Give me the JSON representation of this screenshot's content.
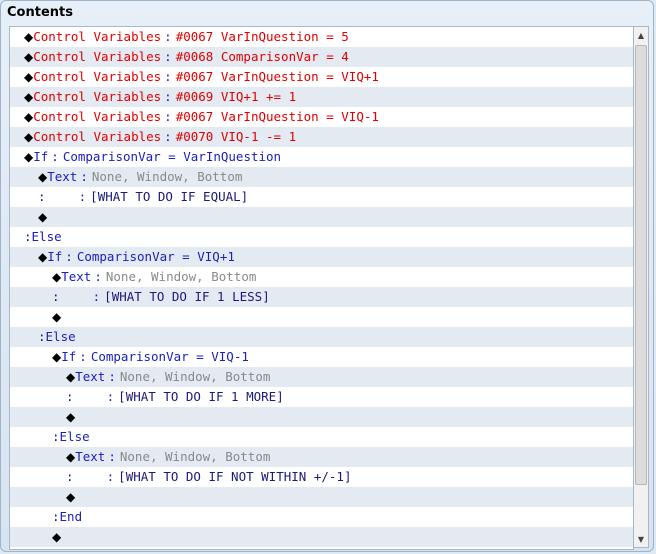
{
  "panel": {
    "title": "Contents"
  },
  "lines": [
    {
      "indent": 0,
      "prefix": "◆",
      "cmd": "Control Variables",
      "cmd_class": "red",
      "sep": ":",
      "args": "#0067 VarInQuestion = 5",
      "args_class": "red"
    },
    {
      "indent": 0,
      "prefix": "◆",
      "cmd": "Control Variables",
      "cmd_class": "red",
      "sep": ":",
      "args": "#0068 ComparisonVar = 4",
      "args_class": "red"
    },
    {
      "indent": 0,
      "prefix": "◆",
      "cmd": "Control Variables",
      "cmd_class": "red",
      "sep": ":",
      "args": "#0067 VarInQuestion = VIQ+1",
      "args_class": "red"
    },
    {
      "indent": 0,
      "prefix": "◆",
      "cmd": "Control Variables",
      "cmd_class": "red",
      "sep": ":",
      "args": "#0069 VIQ+1 += 1",
      "args_class": "red"
    },
    {
      "indent": 0,
      "prefix": "◆",
      "cmd": "Control Variables",
      "cmd_class": "red",
      "sep": ":",
      "args": "#0067 VarInQuestion = VIQ-1",
      "args_class": "red"
    },
    {
      "indent": 0,
      "prefix": "◆",
      "cmd": "Control Variables",
      "cmd_class": "red",
      "sep": ":",
      "args": "#0070 VIQ-1 -= 1",
      "args_class": "red"
    },
    {
      "indent": 0,
      "prefix": "◆",
      "cmd": "If",
      "cmd_class": "blue",
      "sep": ":",
      "args": "ComparisonVar = VarInQuestion",
      "args_class": "blue"
    },
    {
      "indent": 1,
      "prefix": "◆",
      "cmd": "Text",
      "cmd_class": "blue",
      "sep": ":",
      "args": "None, Window, Bottom",
      "args_class": "gray"
    },
    {
      "indent": 1,
      "prefix": ":",
      "cmd": "    ",
      "cmd_class": "navy",
      "sep": ":",
      "args": "[WHAT TO DO IF EQUAL]",
      "args_class": "navy"
    },
    {
      "indent": 1,
      "prefix": "◆",
      "cmd": "",
      "cmd_class": "",
      "sep": "",
      "args": "",
      "args_class": ""
    },
    {
      "indent": 0,
      "prefix": ":",
      "cmd": "Else",
      "cmd_class": "blue",
      "sep": "",
      "args": "",
      "args_class": ""
    },
    {
      "indent": 1,
      "prefix": "◆",
      "cmd": "If",
      "cmd_class": "blue",
      "sep": ":",
      "args": "ComparisonVar = VIQ+1",
      "args_class": "blue"
    },
    {
      "indent": 2,
      "prefix": "◆",
      "cmd": "Text",
      "cmd_class": "blue",
      "sep": ":",
      "args": "None, Window, Bottom",
      "args_class": "gray"
    },
    {
      "indent": 2,
      "prefix": ":",
      "cmd": "    ",
      "cmd_class": "navy",
      "sep": ":",
      "args": "[WHAT TO DO IF 1 LESS]",
      "args_class": "navy"
    },
    {
      "indent": 2,
      "prefix": "◆",
      "cmd": "",
      "cmd_class": "",
      "sep": "",
      "args": "",
      "args_class": ""
    },
    {
      "indent": 1,
      "prefix": ":",
      "cmd": "Else",
      "cmd_class": "blue",
      "sep": "",
      "args": "",
      "args_class": ""
    },
    {
      "indent": 2,
      "prefix": "◆",
      "cmd": "If",
      "cmd_class": "blue",
      "sep": ":",
      "args": "ComparisonVar = VIQ-1",
      "args_class": "blue"
    },
    {
      "indent": 3,
      "prefix": "◆",
      "cmd": "Text",
      "cmd_class": "blue",
      "sep": ":",
      "args": "None, Window, Bottom",
      "args_class": "gray"
    },
    {
      "indent": 3,
      "prefix": ":",
      "cmd": "    ",
      "cmd_class": "navy",
      "sep": ":",
      "args": "[WHAT TO DO IF 1 MORE]",
      "args_class": "navy"
    },
    {
      "indent": 3,
      "prefix": "◆",
      "cmd": "",
      "cmd_class": "",
      "sep": "",
      "args": "",
      "args_class": ""
    },
    {
      "indent": 2,
      "prefix": ":",
      "cmd": "Else",
      "cmd_class": "blue",
      "sep": "",
      "args": "",
      "args_class": ""
    },
    {
      "indent": 3,
      "prefix": "◆",
      "cmd": "Text",
      "cmd_class": "blue",
      "sep": ":",
      "args": "None, Window, Bottom",
      "args_class": "gray"
    },
    {
      "indent": 3,
      "prefix": ":",
      "cmd": "    ",
      "cmd_class": "navy",
      "sep": ":",
      "args": "[WHAT TO DO IF NOT WITHIN +/-1]",
      "args_class": "navy"
    },
    {
      "indent": 3,
      "prefix": "◆",
      "cmd": "",
      "cmd_class": "",
      "sep": "",
      "args": "",
      "args_class": ""
    },
    {
      "indent": 2,
      "prefix": ":",
      "cmd": "End",
      "cmd_class": "blue",
      "sep": "",
      "args": "",
      "args_class": ""
    },
    {
      "indent": 2,
      "prefix": "◆",
      "cmd": "",
      "cmd_class": "",
      "sep": "",
      "args": "",
      "args_class": ""
    }
  ],
  "scrollbar": {
    "up_icon": "▲",
    "down_icon": "▼"
  }
}
